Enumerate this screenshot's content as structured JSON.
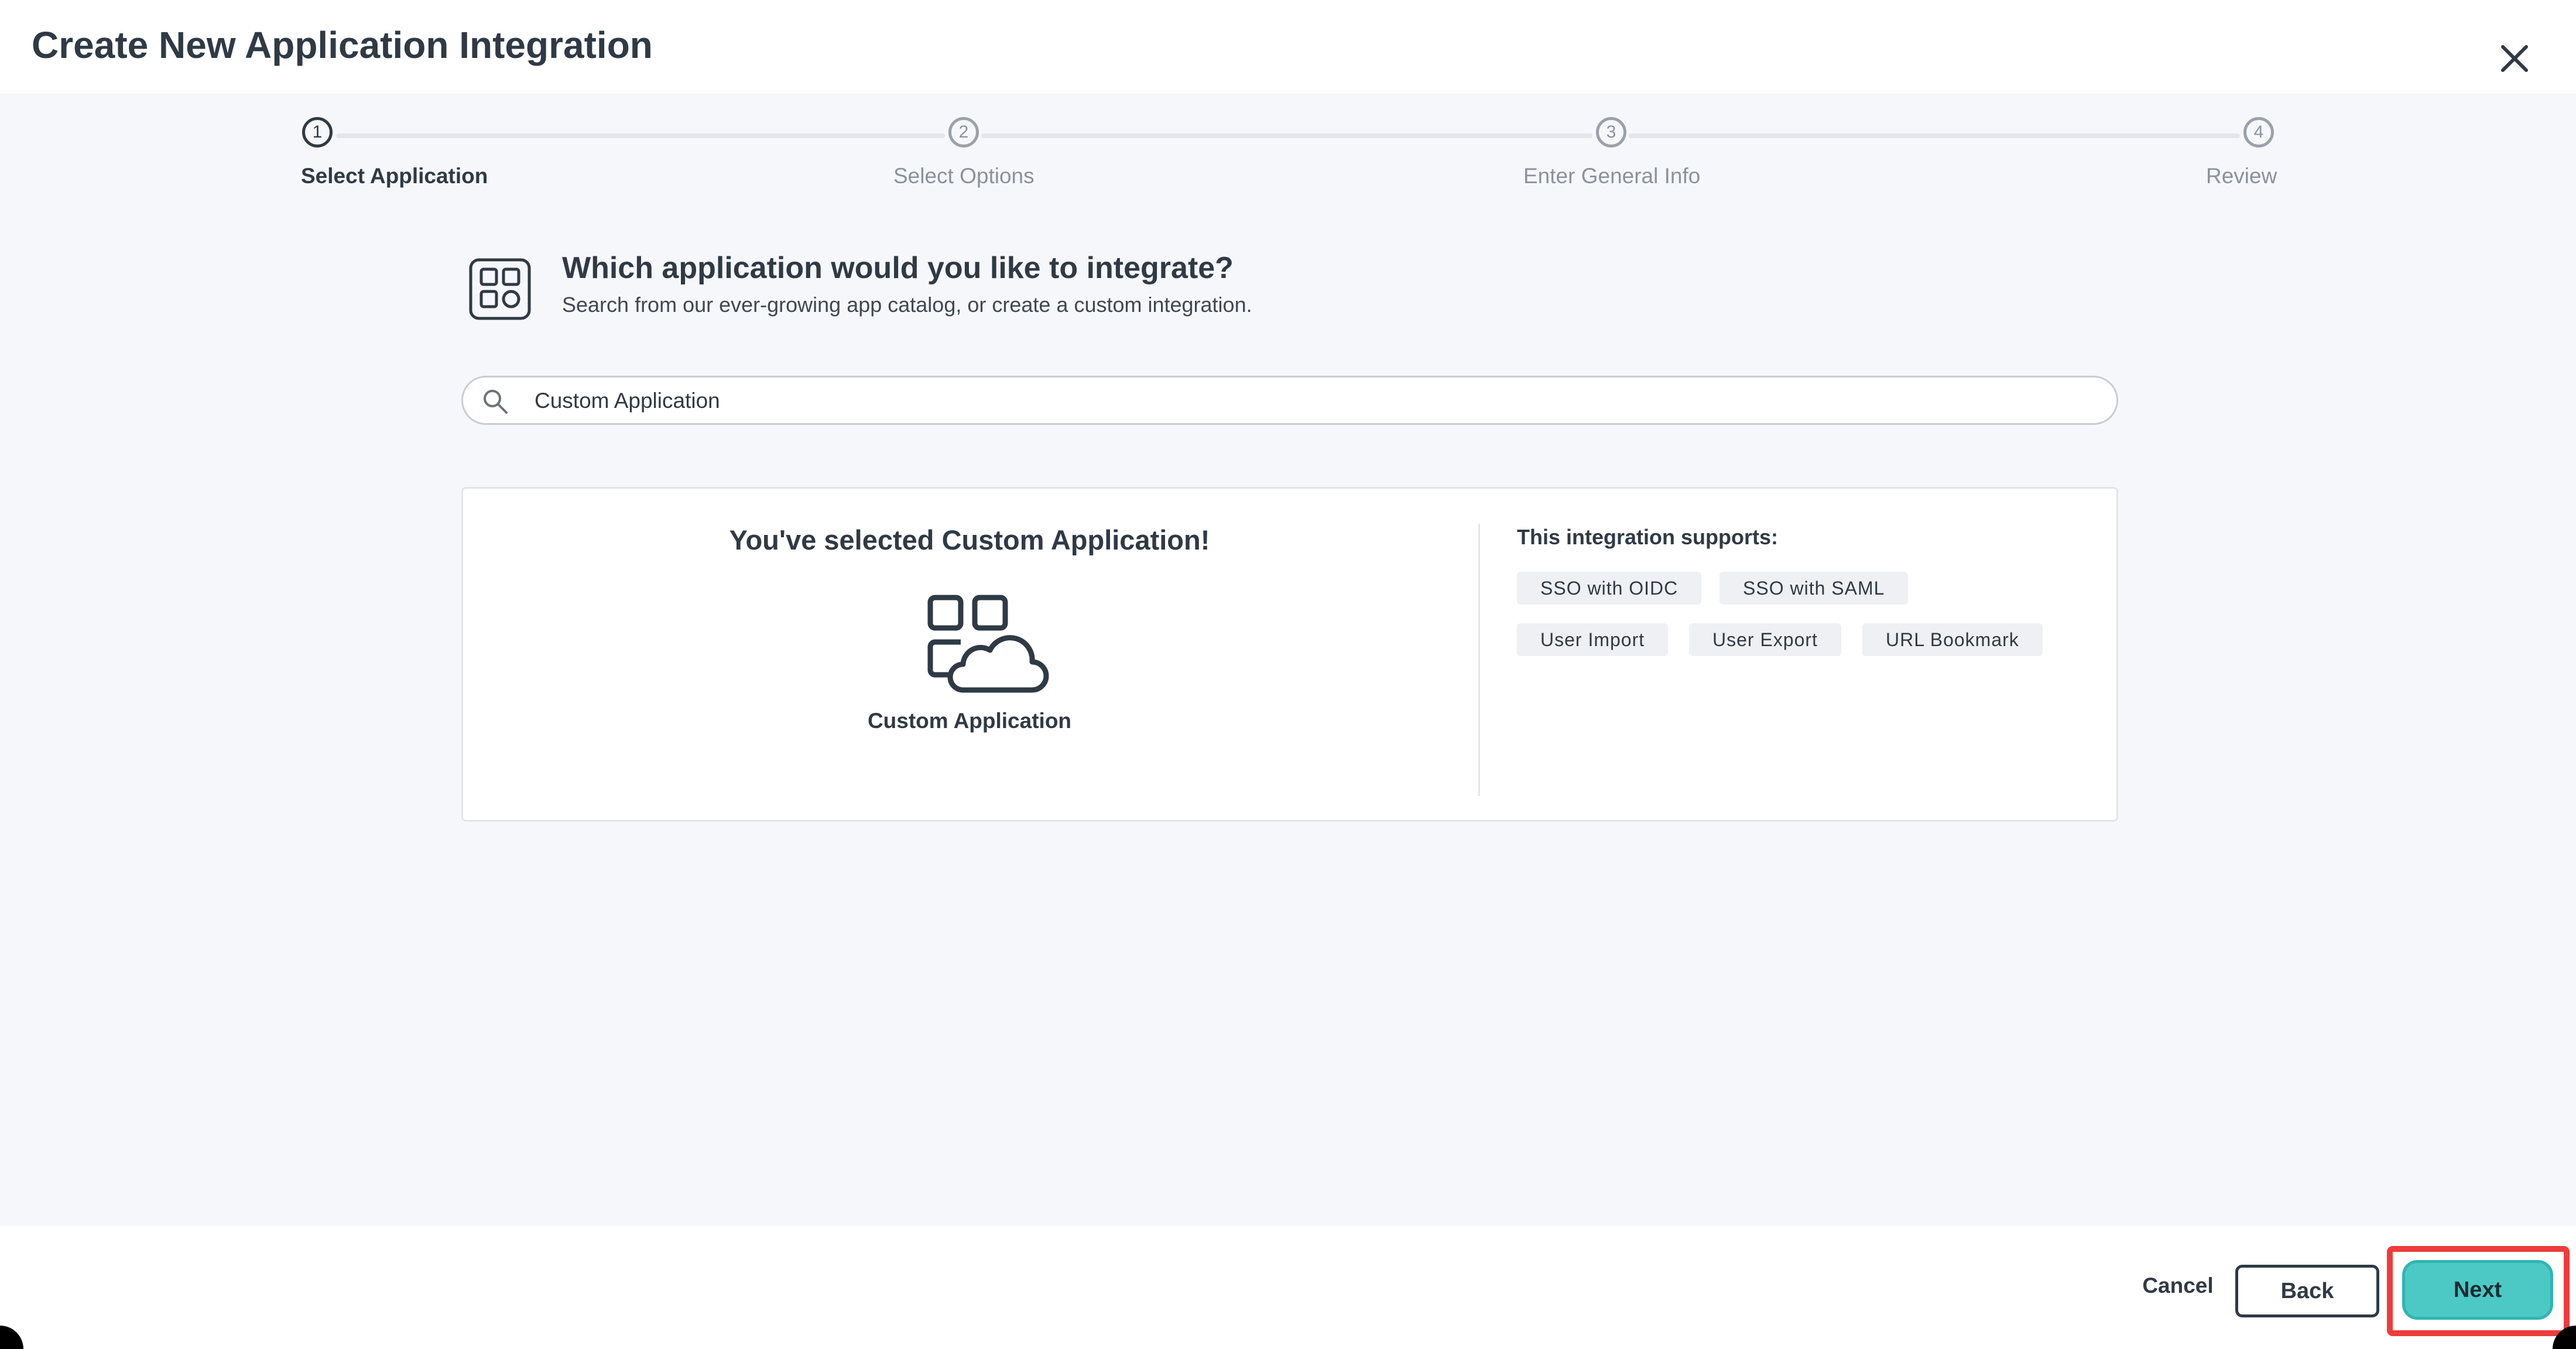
{
  "dialog": {
    "title": "Create New Application Integration",
    "close_icon": "close-icon"
  },
  "stepper": {
    "steps": [
      {
        "number": "1",
        "label": "Select Application",
        "active": true
      },
      {
        "number": "2",
        "label": "Select Options",
        "active": false
      },
      {
        "number": "3",
        "label": "Enter General Info",
        "active": false
      },
      {
        "number": "4",
        "label": "Review",
        "active": false
      }
    ]
  },
  "intro": {
    "icon": "app-grid-icon",
    "title": "Which application would you like to integrate?",
    "subtitle": "Search from our ever-growing app catalog, or create a custom integration."
  },
  "search": {
    "icon": "search-icon",
    "value": "Custom Application",
    "placeholder": ""
  },
  "selection": {
    "heading": "You've selected Custom Application!",
    "app_icon": "custom-app-cloud-icon",
    "app_name": "Custom Application",
    "supports_title": "This integration supports:",
    "tags": [
      "SSO with OIDC",
      "SSO with SAML",
      "User Import",
      "User Export",
      "URL Bookmark"
    ]
  },
  "footer": {
    "cancel_label": "Cancel",
    "back_label": "Back",
    "next_label": "Next"
  },
  "colors": {
    "text": "#2f3a45",
    "muted": "#8a929c",
    "background": "#f6f7fb",
    "accent": "#4cc9c5",
    "highlight": "#ef3b3b"
  }
}
